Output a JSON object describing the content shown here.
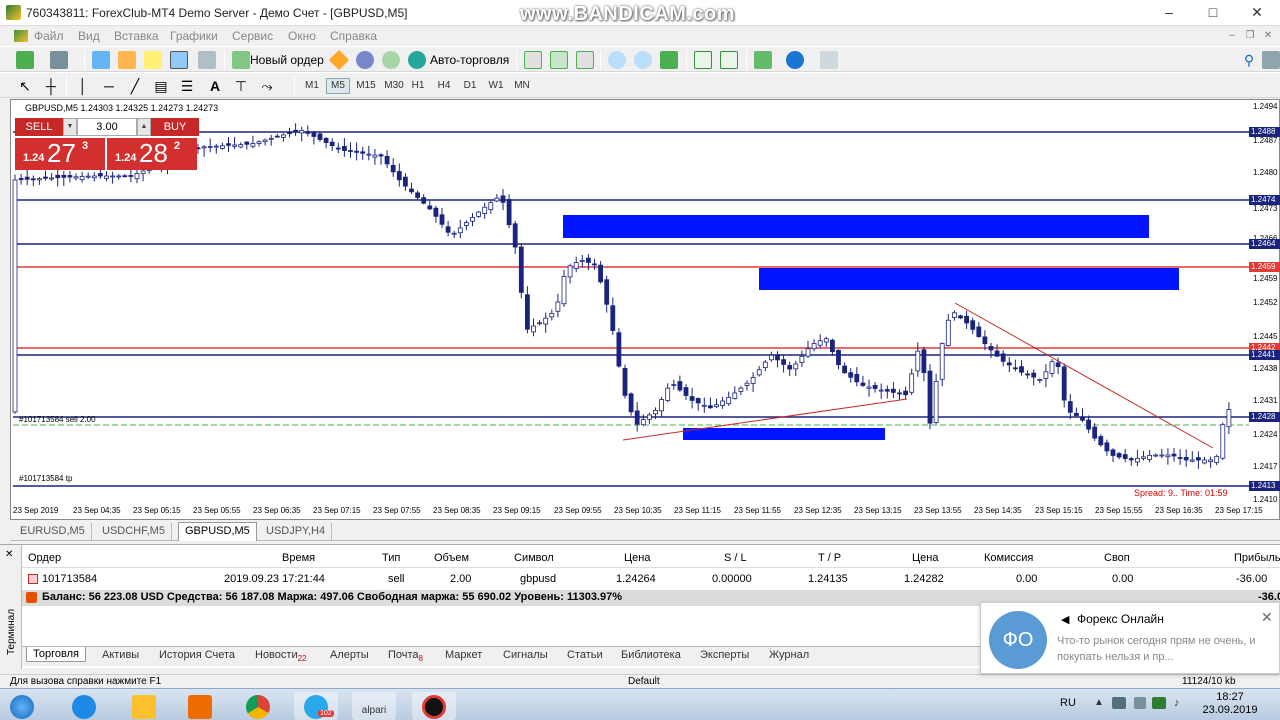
{
  "window": {
    "title": "760343811: ForexClub-MT4 Demo Server - Демо Счет - [GBPUSD,M5]",
    "watermark": "www.BANDICAM.com",
    "min": "–",
    "max": "□",
    "close": "✕"
  },
  "menu": [
    "Файл",
    "Вид",
    "Вставка",
    "Графики",
    "Сервис",
    "Окно",
    "Справка"
  ],
  "toolbar": {
    "new_order": "Новый ордер",
    "auto_trading": "Авто-торговля",
    "timeframes": [
      "M1",
      "M5",
      "M15",
      "M30",
      "H1",
      "H4",
      "D1",
      "W1",
      "MN"
    ],
    "active_timeframe": "M5"
  },
  "chart": {
    "info": "GBPUSD,M5  1.24303 1.24325 1.24273 1.24273",
    "order_label_sell": "#101713584 sell 2.00",
    "order_label_tp": "#101713584 tp",
    "spread": "Spread: 9.. Time: 01:59",
    "trade_panel": {
      "sell": "SELL",
      "buy": "BUY",
      "lot": "3.00",
      "sell_small": "1.24",
      "sell_big": "27",
      "sell_sup": "3",
      "buy_small": "1.24",
      "buy_big": "28",
      "buy_sup": "2"
    },
    "y_labels": [
      "1.2494",
      "1.2487",
      "1.2480",
      "1.2473",
      "1.2466",
      "1.2459",
      "1.2452",
      "1.2445",
      "1.2438",
      "1.2431",
      "1.2424",
      "1.2417",
      "1.2410"
    ],
    "price_tags": [
      {
        "text": "1.2488",
        "color": "#1a237e"
      },
      {
        "text": "1.2474",
        "color": "#1a237e"
      },
      {
        "text": "1.2464",
        "color": "#1a237e"
      },
      {
        "text": "1.2459",
        "color": "#e53935"
      },
      {
        "text": "1.2442",
        "color": "#e53935"
      },
      {
        "text": "1.2441",
        "color": "#1a237e"
      },
      {
        "text": "1.2428",
        "color": "#1a237e"
      },
      {
        "text": "1.2413",
        "color": "#1a237e"
      }
    ],
    "x_labels": [
      "23 Sep 2019",
      "23 Sep 04:35",
      "23 Sep 05:15",
      "23 Sep 05:55",
      "23 Sep 06:35",
      "23 Sep 07:15",
      "23 Sep 07:55",
      "23 Sep 08:35",
      "23 Sep 09:15",
      "23 Sep 09:55",
      "23 Sep 10:35",
      "23 Sep 11:15",
      "23 Sep 11:55",
      "23 Sep 12:35",
      "23 Sep 13:15",
      "23 Sep 13:55",
      "23 Sep 14:35",
      "23 Sep 15:15",
      "23 Sep 15:55",
      "23 Sep 16:35",
      "23 Sep 17:15"
    ],
    "colors": {
      "candle": "#1a237e",
      "support": "#1a237e",
      "resistance": "#e53935",
      "zone": "#0014ff",
      "trend": "#c62828"
    }
  },
  "symbol_tabs": [
    "EURUSD,M5",
    "USDCHF,M5",
    "GBPUSD,M5",
    "USDJPY,H4"
  ],
  "active_symbol_tab": "GBPUSD,M5",
  "terminal": {
    "side_label": "Терминал",
    "headers": [
      "Ордер",
      "Время",
      "Тип",
      "Объем",
      "Символ",
      "Цена",
      "S / L",
      "T / P",
      "Цена",
      "Комиссия",
      "Своп",
      "Прибыль"
    ],
    "row": [
      "101713584",
      "2019.09.23 17:21:44",
      "sell",
      "2.00",
      "gbpusd",
      "1.24264",
      "0.00000",
      "1.24135",
      "1.24282",
      "0.00",
      "0.00",
      "-36.00"
    ],
    "balance": "Баланс: 56 223.08 USD  Средства: 56 187.08  Маржа: 497.06  Свободная маржа: 55 690.02  Уровень: 11303.97%",
    "balance_pl": "-36.00",
    "tabs": [
      {
        "label": "Торговля",
        "badge": ""
      },
      {
        "label": "Активы",
        "badge": ""
      },
      {
        "label": "История Счета",
        "badge": ""
      },
      {
        "label": "Новости",
        "badge": "22"
      },
      {
        "label": "Алерты",
        "badge": ""
      },
      {
        "label": "Почта",
        "badge": "8"
      },
      {
        "label": "Маркет",
        "badge": ""
      },
      {
        "label": "Сигналы",
        "badge": ""
      },
      {
        "label": "Статьи",
        "badge": ""
      },
      {
        "label": "Библиотека",
        "badge": ""
      },
      {
        "label": "Эксперты",
        "badge": ""
      },
      {
        "label": "Журнал",
        "badge": ""
      }
    ]
  },
  "statusbar": {
    "help": "Для вызова справки нажмите F1",
    "profile": "Default",
    "traffic": "11124/10 kb"
  },
  "notification": {
    "avatar": "ФО",
    "title": "Форекс Онлайн",
    "body": "Что-то рынок сегодня прям не очень, и покупать нельзя и пр...",
    "close": "✕"
  },
  "taskbar": {
    "alpari": "alpari",
    "telegram_badge": "102",
    "lang": "RU",
    "time": "18:27",
    "date": "23.09.2019"
  }
}
